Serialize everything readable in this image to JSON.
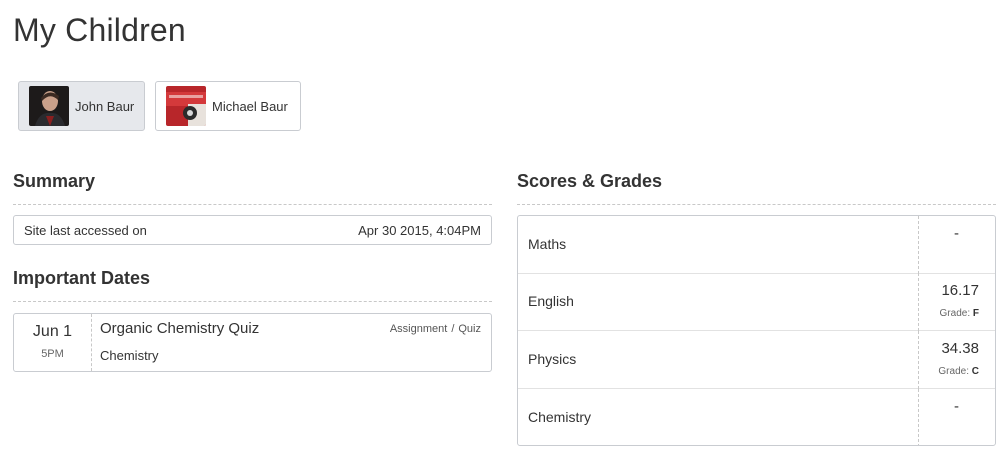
{
  "page": {
    "title": "My Children"
  },
  "children": [
    {
      "name": "John Baur",
      "active": true,
      "avatar": "portrait-photo"
    },
    {
      "name": "Michael Baur",
      "active": false,
      "avatar": "red-poster-image"
    }
  ],
  "summary": {
    "title": "Summary",
    "row": {
      "label": "Site last accessed on",
      "value": "Apr 30 2015, 4:04PM"
    }
  },
  "important_dates": {
    "title": "Important Dates",
    "events": [
      {
        "day": "Jun 1",
        "time": "5PM",
        "name": "Organic Chemistry Quiz",
        "course": "Chemistry",
        "type_a": "Assignment",
        "type_sep": "/",
        "type_b": "Quiz"
      }
    ]
  },
  "scores": {
    "title": "Scores & Grades",
    "rows": [
      {
        "subject": "Maths",
        "score": "-",
        "grade_label": "",
        "grade": ""
      },
      {
        "subject": "English",
        "score": "16.17",
        "grade_label": "Grade:",
        "grade": "F"
      },
      {
        "subject": "Physics",
        "score": "34.38",
        "grade_label": "Grade:",
        "grade": "C"
      },
      {
        "subject": "Chemistry",
        "score": "-",
        "grade_label": "",
        "grade": ""
      }
    ]
  },
  "colors": {
    "active_tab_bg": "#e6e8ec",
    "border": "#c9ccd1",
    "text": "#333333"
  }
}
